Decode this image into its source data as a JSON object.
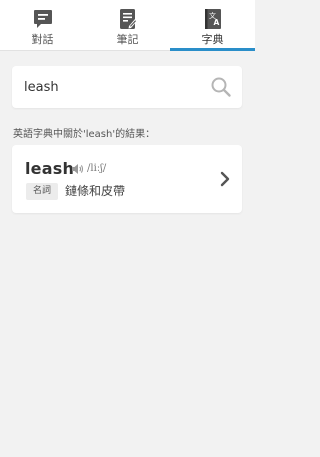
{
  "tabs": [
    {
      "label": "對話",
      "icon": "chat-icon",
      "active": false
    },
    {
      "label": "筆記",
      "icon": "notes-icon",
      "active": false
    },
    {
      "label": "字典",
      "icon": "dictionary-icon",
      "active": true
    }
  ],
  "search": {
    "value": "leash",
    "icon": "search-icon"
  },
  "results": {
    "heading": "英語字典中關於'leash'的結果：",
    "items": [
      {
        "word": "leash",
        "phonetic": "/liːʃ/",
        "part_of_speech": "名詞",
        "definition": "鏈條和皮帶"
      }
    ]
  },
  "colors": {
    "accent": "#2a8ec9",
    "background": "#f2f2f2",
    "card": "#ffffff"
  }
}
